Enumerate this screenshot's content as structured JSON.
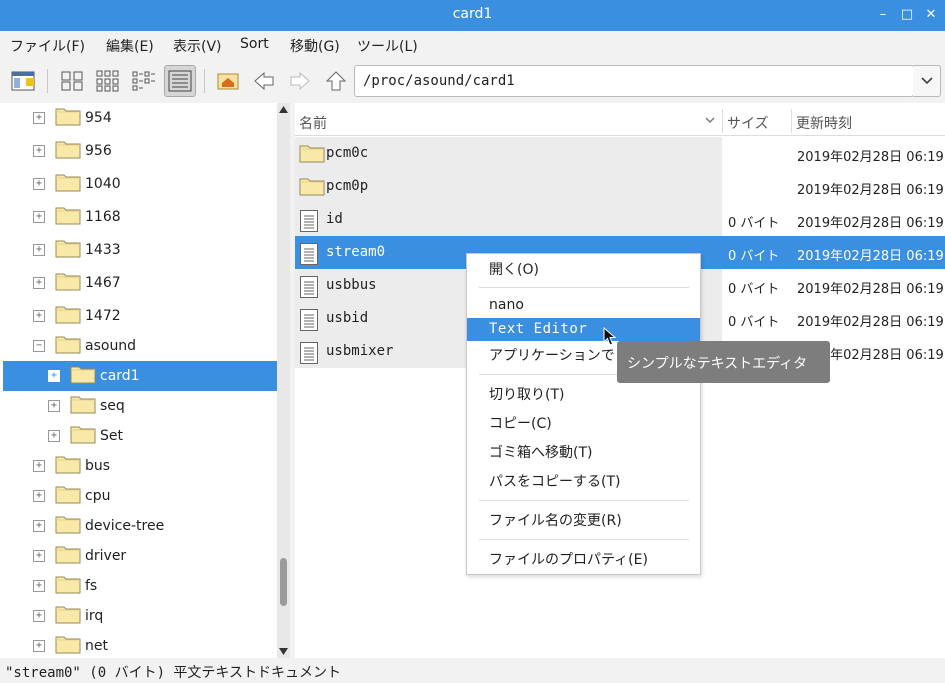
{
  "window": {
    "title": "card1",
    "minimize": "–",
    "maximize": "□",
    "close": "✕"
  },
  "menubar": [
    "ファイル(F)",
    "編集(E)",
    "表示(V)",
    "Sort",
    "移動(G)",
    "ツール(L)"
  ],
  "toolbar": {
    "path": "/proc/asound/card1"
  },
  "tree": [
    {
      "label": "954",
      "level": 0,
      "expander": "+"
    },
    {
      "label": "956",
      "level": 0,
      "expander": "+"
    },
    {
      "label": "1040",
      "level": 0,
      "expander": "+"
    },
    {
      "label": "1168",
      "level": 0,
      "expander": "+"
    },
    {
      "label": "1433",
      "level": 0,
      "expander": "+"
    },
    {
      "label": "1467",
      "level": 0,
      "expander": "+"
    },
    {
      "label": "1472",
      "level": 0,
      "expander": "+"
    },
    {
      "label": "asound",
      "level": 0,
      "expander": "−"
    },
    {
      "label": "card1",
      "level": 1,
      "expander": "+",
      "selected": true
    },
    {
      "label": "seq",
      "level": 1,
      "expander": "+"
    },
    {
      "label": "Set",
      "level": 1,
      "expander": "+"
    },
    {
      "label": "bus",
      "level": 0,
      "expander": "+"
    },
    {
      "label": "cpu",
      "level": 0,
      "expander": "+"
    },
    {
      "label": "device-tree",
      "level": 0,
      "expander": "+"
    },
    {
      "label": "driver",
      "level": 0,
      "expander": "+"
    },
    {
      "label": "fs",
      "level": 0,
      "expander": "+"
    },
    {
      "label": "irq",
      "level": 0,
      "expander": "+"
    },
    {
      "label": "net",
      "level": 0,
      "expander": "+"
    }
  ],
  "list": {
    "headers": {
      "name": "名前",
      "size": "サイズ",
      "modified": "更新時刻"
    },
    "rows": [
      {
        "name": "pcm0c",
        "type": "folder",
        "size": "",
        "date": "2019年02月28日 06:19"
      },
      {
        "name": "pcm0p",
        "type": "folder",
        "size": "",
        "date": "2019年02月28日 06:19"
      },
      {
        "name": "id",
        "type": "file",
        "size": "0 バイト",
        "date": "2019年02月28日 06:19"
      },
      {
        "name": "stream0",
        "type": "file",
        "size": "0 バイト",
        "date": "2019年02月28日 06:19",
        "selected": true
      },
      {
        "name": "usbbus",
        "type": "file",
        "size": "0 バイト",
        "date": "2019年02月28日 06:19"
      },
      {
        "name": "usbid",
        "type": "file",
        "size": "0 バイト",
        "date": "2019年02月28日 06:19"
      },
      {
        "name": "usbmixer",
        "type": "file",
        "size": "",
        "date": "2019年02月28日 06:19"
      }
    ]
  },
  "context_menu": {
    "open": "開く(O)",
    "nano": "nano",
    "text_editor": "Text Editor",
    "applications": "アプリケーションで",
    "cut": "切り取り(T)",
    "copy": "コピー(C)",
    "trash": "ゴミ箱へ移動(T)",
    "copy_path": "パスをコピーする(T)",
    "rename": "ファイル名の変更(R)",
    "properties": "ファイルのプロパティ(E)"
  },
  "tooltip": "シンプルなテキストエディタ",
  "status": "\"stream0\" (0 バイト) 平文テキストドキュメント",
  "colors": {
    "accent": "#3b8fe0",
    "folder": "#f8e9a8"
  }
}
